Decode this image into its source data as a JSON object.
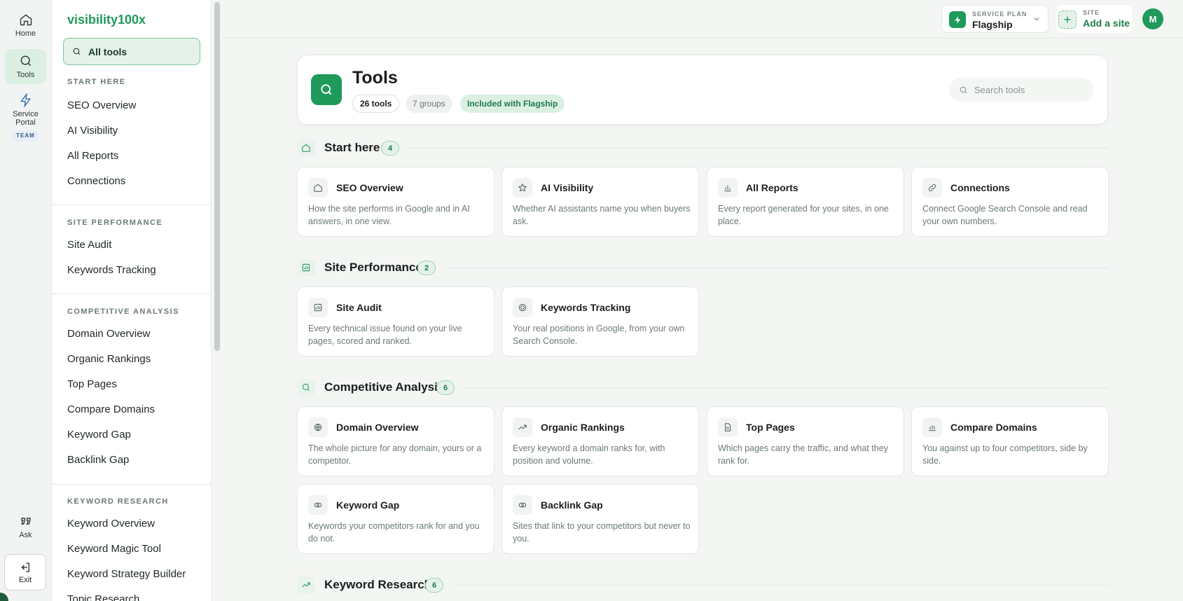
{
  "rail": {
    "home": "Home",
    "tools": "Tools",
    "service_portal_1": "Service",
    "service_portal_2": "Portal",
    "team_badge": "TEAM",
    "ask": "Ask",
    "exit": "Exit"
  },
  "sidebar": {
    "brand": "visibility100x",
    "all_tools": "All tools",
    "sections": [
      {
        "label": "START HERE",
        "items": [
          "SEO Overview",
          "AI Visibility",
          "All Reports",
          "Connections"
        ]
      },
      {
        "label": "SITE PERFORMANCE",
        "items": [
          "Site Audit",
          "Keywords Tracking"
        ]
      },
      {
        "label": "COMPETITIVE ANALYSIS",
        "items": [
          "Domain Overview",
          "Organic Rankings",
          "Top Pages",
          "Compare Domains",
          "Keyword Gap",
          "Backlink Gap"
        ]
      },
      {
        "label": "KEYWORD RESEARCH",
        "items": [
          "Keyword Overview",
          "Keyword Magic Tool",
          "Keyword Strategy Builder",
          "Topic Research"
        ]
      }
    ]
  },
  "topbar": {
    "plan_label": "SERVICE PLAN",
    "plan_value": "Flagship",
    "site_label": "SITE",
    "site_value": "Add a site",
    "avatar": "M"
  },
  "header": {
    "title": "Tools",
    "chip_tools": "26 tools",
    "chip_groups": "7 groups",
    "chip_included": "Included with Flagship",
    "search_placeholder": "Search tools"
  },
  "groups": [
    {
      "title": "Start here",
      "count": "4",
      "cards": [
        {
          "icon": "home-icon",
          "title": "SEO Overview",
          "desc": "How the site performs in Google and in AI answers, in one view."
        },
        {
          "icon": "star-icon",
          "title": "AI Visibility",
          "desc": "Whether AI assistants name you when buyers ask."
        },
        {
          "icon": "bar-chart-icon",
          "title": "All Reports",
          "desc": "Every report generated for your sites, in one place."
        },
        {
          "icon": "link-icon",
          "title": "Connections",
          "desc": "Connect Google Search Console and read your own numbers."
        }
      ]
    },
    {
      "title": "Site Performance",
      "count": "2",
      "cards": [
        {
          "icon": "audit-icon",
          "title": "Site Audit",
          "desc": "Every technical issue found on your live pages, scored and ranked."
        },
        {
          "icon": "target-icon",
          "title": "Keywords Tracking",
          "desc": "Your real positions in Google, from your own Search Console."
        }
      ]
    },
    {
      "title": "Competitive Analysis",
      "count": "6",
      "cards": [
        {
          "icon": "globe-icon",
          "title": "Domain Overview",
          "desc": "The whole picture for any domain, yours or a competitor."
        },
        {
          "icon": "trend-icon",
          "title": "Organic Rankings",
          "desc": "Every keyword a domain ranks for, with position and volume."
        },
        {
          "icon": "page-icon",
          "title": "Top Pages",
          "desc": "Which pages carry the traffic, and what they rank for."
        },
        {
          "icon": "compare-icon",
          "title": "Compare Domains",
          "desc": "You against up to four competitors, side by side."
        },
        {
          "icon": "overlap-icon",
          "title": "Keyword Gap",
          "desc": "Keywords your competitors rank for and you do not."
        },
        {
          "icon": "overlap-icon",
          "title": "Backlink Gap",
          "desc": "Sites that link to your competitors but never to you."
        }
      ]
    },
    {
      "title": "Keyword Research",
      "count": "6",
      "cards": []
    }
  ]
}
